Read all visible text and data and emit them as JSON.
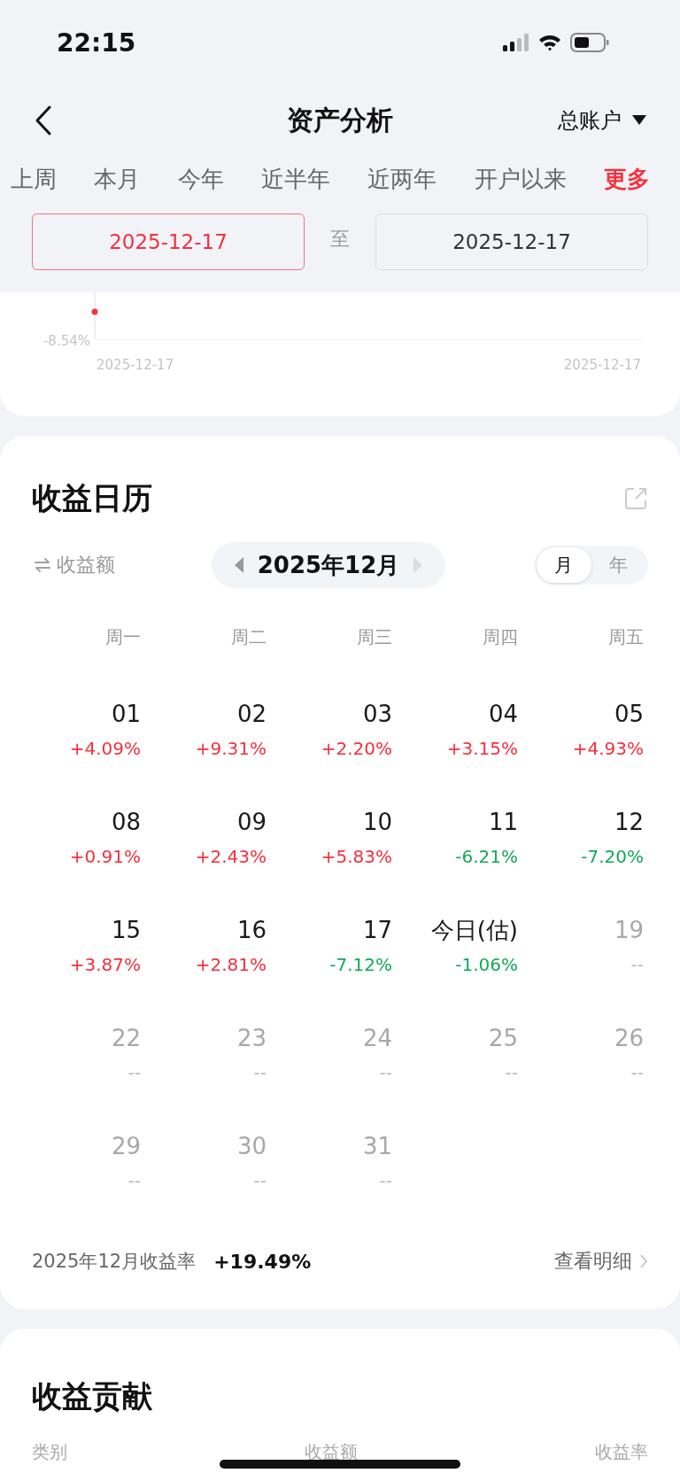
{
  "status_bar": {
    "time": "22:15"
  },
  "nav": {
    "title": "资产分析",
    "account": "总账户"
  },
  "period_tabs": [
    {
      "label": "上周",
      "selected": false
    },
    {
      "label": "本月",
      "selected": false
    },
    {
      "label": "今年",
      "selected": false
    },
    {
      "label": "近半年",
      "selected": false
    },
    {
      "label": "近两年",
      "selected": false
    },
    {
      "label": "开户以来",
      "selected": false
    },
    {
      "label": "更多",
      "selected": true
    }
  ],
  "date_range": {
    "start": {
      "value": "2025-12-17",
      "selected": true
    },
    "separator": "至",
    "end": {
      "value": "2025-12-17",
      "selected": false
    }
  },
  "chart": {
    "y_label": "-8.54%",
    "x_start": "2025-12-17",
    "x_end": "2025-12-17"
  },
  "calendar": {
    "title": "收益日历",
    "metric": "收益额",
    "month": "2025年12月",
    "view_toggle": [
      {
        "label": "月",
        "selected": true
      },
      {
        "label": "年",
        "selected": false
      }
    ],
    "weekdays": [
      "周一",
      "周二",
      "周三",
      "周四",
      "周五"
    ],
    "weeks": [
      [
        {
          "day": "01",
          "value": "+4.09%",
          "color": "#f5303d",
          "upcoming": false
        },
        {
          "day": "02",
          "value": "+9.31%",
          "color": "#f5303d",
          "upcoming": false
        },
        {
          "day": "03",
          "value": "+2.20%",
          "color": "#f5303d",
          "upcoming": false
        },
        {
          "day": "04",
          "value": "+3.15%",
          "color": "#f5303d",
          "upcoming": false
        },
        {
          "day": "05",
          "value": "+4.93%",
          "color": "#f5303d",
          "upcoming": false
        }
      ],
      [
        {
          "day": "08",
          "value": "+0.91%",
          "color": "#f5303d",
          "upcoming": false
        },
        {
          "day": "09",
          "value": "+2.43%",
          "color": "#f5303d",
          "upcoming": false
        },
        {
          "day": "10",
          "value": "+5.83%",
          "color": "#f5303d",
          "upcoming": false
        },
        {
          "day": "11",
          "value": "-6.21%",
          "color": "#14a85a",
          "upcoming": false
        },
        {
          "day": "12",
          "value": "-7.20%",
          "color": "#14a85a",
          "upcoming": false
        }
      ],
      [
        {
          "day": "15",
          "value": "+3.87%",
          "color": "#f5303d",
          "upcoming": false
        },
        {
          "day": "16",
          "value": "+2.81%",
          "color": "#f5303d",
          "upcoming": false
        },
        {
          "day": "17",
          "value": "-7.12%",
          "color": "#14a85a",
          "upcoming": false
        },
        {
          "day": "今日(估)",
          "value": "-1.06%",
          "color": "#14a85a",
          "upcoming": false
        },
        {
          "day": "19",
          "value": "--",
          "color": "#b8b8b8",
          "upcoming": true
        }
      ],
      [
        {
          "day": "22",
          "value": "--",
          "color": "#b8b8b8",
          "upcoming": true
        },
        {
          "day": "23",
          "value": "--",
          "color": "#b8b8b8",
          "upcoming": true
        },
        {
          "day": "24",
          "value": "--",
          "color": "#b8b8b8",
          "upcoming": true
        },
        {
          "day": "25",
          "value": "--",
          "color": "#b8b8b8",
          "upcoming": true
        },
        {
          "day": "26",
          "value": "--",
          "color": "#b8b8b8",
          "upcoming": true
        }
      ],
      [
        {
          "day": "29",
          "value": "--",
          "color": "#b8b8b8",
          "upcoming": true
        },
        {
          "day": "30",
          "value": "--",
          "color": "#b8b8b8",
          "upcoming": true
        },
        {
          "day": "31",
          "value": "--",
          "color": "#b8b8b8",
          "upcoming": true
        }
      ]
    ],
    "summary_label": "2025年12月收益率",
    "summary_value": "+19.49%",
    "detail_link": "查看明细"
  },
  "contribution": {
    "title": "收益贡献",
    "columns": [
      "类别",
      "收益额",
      "收益率"
    ]
  }
}
